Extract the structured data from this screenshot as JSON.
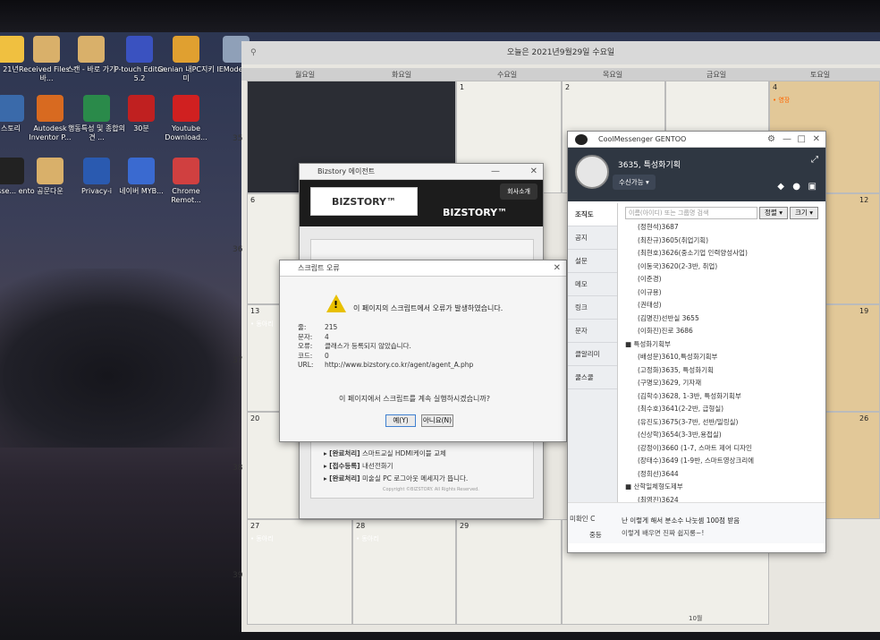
{
  "desktop": {
    "icons": [
      {
        "label": "21년",
        "c": "#f0c040"
      },
      {
        "label": "Received Files - 바...",
        "c": "#d9b06a"
      },
      {
        "label": "스캔 - 바로 가기",
        "c": "#d9b06a"
      },
      {
        "label": "P-touch Editor 5.2",
        "c": "#3a52c0"
      },
      {
        "label": "Genian 내PC지키미",
        "c": "#e0a030"
      },
      {
        "label": "IEMode_v1",
        "c": "#8fa0b8"
      },
      {
        "label": "스토리",
        "c": "#3a6aaa"
      },
      {
        "label": "Autodesk Inventor P...",
        "c": "#d86a20"
      },
      {
        "label": "행동특성 및 종합의견 ...",
        "c": "#2a8a4a"
      },
      {
        "label": "30분",
        "c": "#c02020"
      },
      {
        "label": "Youtube Download...",
        "c": "#d02020"
      },
      {
        "label": "Messe... ento",
        "c": "#222"
      },
      {
        "label": "공문다운",
        "c": "#d9b06a"
      },
      {
        "label": "Privacy-i",
        "c": "#2a5ab0"
      },
      {
        "label": "네이버 MYB...",
        "c": "#3a6ad0"
      },
      {
        "label": "Chrome Remot...",
        "c": "#d04040"
      }
    ]
  },
  "calendar": {
    "title": "오늘은 2021년9월29일 수요일",
    "days": [
      "월요일",
      "화요일",
      "수요일",
      "목요일",
      "금요일",
      "토요일"
    ],
    "weeks": [
      "35",
      "36",
      "37",
      "38",
      "39"
    ],
    "dates": [
      "1",
      "2",
      "3",
      "4",
      "6",
      "12",
      "13",
      "19",
      "20",
      "26",
      "27",
      "28",
      "29"
    ],
    "events": {
      "sat4": "• 영장",
      "w37a": "• 동아리",
      "w37b": "• 동아리",
      "w39a": "• 동아리",
      "w39b": "• 동아리"
    },
    "footer": "10월"
  },
  "bizstory": {
    "title": "Bizstory 에이전트",
    "logo": "BIZSTORY™",
    "logo2": "BIZSTORY™",
    "tab": "회사소개",
    "items": [
      {
        "tag": "[완료처리]",
        "text": "스마트교실 HDMI케이블 교체"
      },
      {
        "tag": "[접수등록]",
        "text": "내선전화기"
      },
      {
        "tag": "[완료처리]",
        "text": "미술실 PC 로그아웃 메세지가 뜹니다."
      }
    ],
    "copyright": "Copyright ©BIZSTORY. All Rights Reserved."
  },
  "script_error": {
    "title": "스크립트 오류",
    "message": "이 페이지의 스크립트에서 오류가 발생하였습니다.",
    "fields": [
      {
        "k": "줄:",
        "v": "215"
      },
      {
        "k": "문자:",
        "v": "4"
      },
      {
        "k": "오류:",
        "v": "클래스가 등록되지 않았습니다."
      },
      {
        "k": "코드:",
        "v": "0"
      },
      {
        "k": "URL:",
        "v": "http://www.bizstory.co.kr/agent/agent_A.php"
      }
    ],
    "question": "이 페이지에서 스크립트를 계속 실행하시겠습니까?",
    "yes": "예(Y)",
    "no": "아니요(N)"
  },
  "messenger": {
    "title": "CoolMessenger GENTOO",
    "user": "3635, 특성화기획",
    "status": "수신가능 ▾",
    "side": [
      "조직도",
      "공지",
      "설문",
      "메모",
      "링크",
      "문자",
      "클알리미",
      "쿨스쿨"
    ],
    "search_placeholder": "이름(아이디) 또는 그룹명 검색",
    "sort": "정렬 ▾",
    "size": "크기 ▾",
    "list": [
      "(정현석)3687",
      "(최찬규)3605(취업기획)",
      "(최현호)3626(중소기업 인력양성사업)",
      "(이동국)3620(2-3반, 취업)",
      "(이준경)",
      "(이규용)",
      "(권태성)",
      "(김명진)선반실 3655",
      "(이화진)진로 3686",
      "■ 특성화기획부",
      "(배성문)3610,특성화기획부",
      "(고정화)3635, 특성화기획",
      "(구명모)3629, 기자재",
      "(김학수)3628, 1-3반, 특성화기획부",
      "(최수호)3641(2-2반, 급형실)",
      "(유진도)3675(3-7반, 선반/밀링실)",
      "(신상학)3654(3-3반,용접실)",
      "(강정이)3660 (1-7, 스마트 제어 디자인",
      "(장태수)3649 (1-9반, 스마트영상크리에",
      "(정희선)3644",
      "■ 산학일체형도제부",
      "(최영진)3624"
    ],
    "unread": "미확인 C",
    "notice": "난 이렇게 해서 분소수 나눗셈 100점 받음",
    "notice_sub": "이렇게 배우면 진짜 쉽지롱~!",
    "foot2": "중등"
  }
}
